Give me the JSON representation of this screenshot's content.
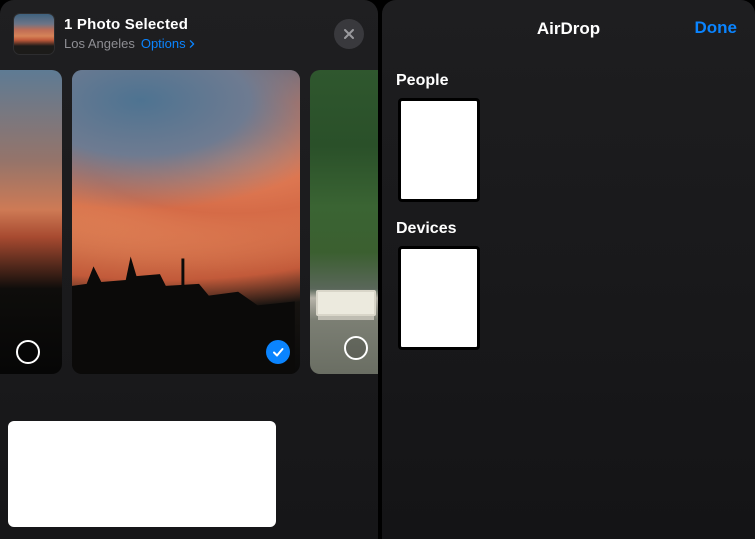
{
  "left": {
    "title": "1 Photo Selected",
    "location": "Los Angeles",
    "options_label": "Options",
    "photos": [
      {
        "selected": false
      },
      {
        "selected": true
      },
      {
        "selected": false
      }
    ]
  },
  "right": {
    "title": "AirDrop",
    "done_label": "Done",
    "sections": {
      "people_label": "People",
      "devices_label": "Devices"
    }
  },
  "colors": {
    "accent": "#0a84ff"
  }
}
